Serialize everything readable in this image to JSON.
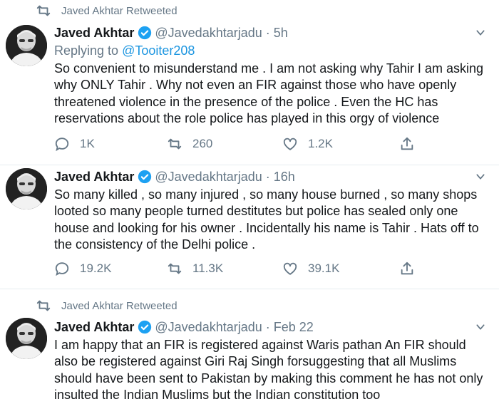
{
  "tweets": [
    {
      "retweeted_by": "Javed Akhtar Retweeted",
      "name": "Javed Akhtar",
      "handle": "@Javedakhtarjadu",
      "separator": "·",
      "time": "5h",
      "replying_prefix": "Replying to",
      "replying_to": "@Tooiter208",
      "text": "So convenient to misunderstand me . I am not asking why Tahir I am asking why ONLY Tahir . Why not even an FIR against those who have openly threatened violence in the presence of the police . Even the HC has reservations about the role police has played in this orgy of violence",
      "replies": "1K",
      "retweets": "260",
      "likes": "1.2K"
    },
    {
      "name": "Javed Akhtar",
      "handle": "@Javedakhtarjadu",
      "separator": "·",
      "time": "16h",
      "text": "So many killed , so many injured , so many house burned , so many shops looted so many people turned destitutes but  police has sealed only one house and looking for his owner . Incidentally his name is Tahir . Hats off to the consistency of the Delhi police .",
      "replies": "19.2K",
      "retweets": "11.3K",
      "likes": "39.1K"
    },
    {
      "retweeted_by": "Javed Akhtar Retweeted",
      "name": "Javed Akhtar",
      "handle": "@Javedakhtarjadu",
      "separator": "·",
      "time": "Feb 22",
      "text": "I am happy that an FIR is registered against Waris pathan An FIR should also be registered against Giri Raj Singh forsuggesting that all Muslims should have been sent to Pakistan by making this  comment he has not only insulted the Indian Muslims but the Indian constitution too"
    }
  ],
  "icons": {
    "retweeted": "retweet-icon",
    "verified": "verified-badge-icon",
    "menu": "chevron-down-icon",
    "reply": "reply-icon",
    "retweet": "retweet-icon",
    "like": "heart-icon",
    "share": "share-icon"
  },
  "colors": {
    "accent": "#1b95e0",
    "muted": "#657786",
    "text": "#14171a",
    "divider": "#e6ecf0"
  }
}
